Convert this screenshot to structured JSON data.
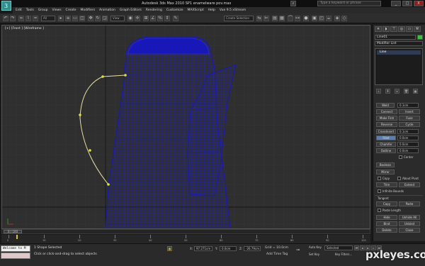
{
  "window": {
    "title": "Autodesk 3ds Max 2010 SP1   enamelware pov.max",
    "help_search_placeholder": "Type a keyword or phrase",
    "min": "_",
    "max": "□",
    "close": "X"
  },
  "menu": [
    "Edit",
    "Tools",
    "Group",
    "Views",
    "Create",
    "Modifiers",
    "Animation",
    "Graph Editors",
    "Rendering",
    "Customize",
    "MAXScript",
    "Help",
    "Vue 9.5 xStream"
  ],
  "toolbar": {
    "filter_dropdown": "All",
    "view_dropdown": "View",
    "selection_set": "Create Selection"
  },
  "viewport": {
    "label": "[ + ] [ Front ] [ Wireframe ]",
    "label_text": "[+] [Front ] [Wireframe ]"
  },
  "command_panel": {
    "object_name": "Line01",
    "modifier_list": "Modifier List",
    "stack_item": "Line",
    "buttons": {
      "weld": "Weld",
      "weld_val": "0.1cm",
      "connect": "Connect",
      "insert": "Insert",
      "make_first": "Make First",
      "fuse": "Fuse",
      "reverse": "Reverse",
      "cycle": "Cycle",
      "crossinsert": "CrossInsert",
      "crossinsert_val": "0.1cm",
      "fillet": "Fillet",
      "fillet_val": "0.0cm",
      "chamfer": "Chamfer",
      "chamfer_val": "0.0cm",
      "outline": "Outline",
      "outline_val": "0.0cm",
      "mirror_label": "Mirror",
      "boolean": "Boolean",
      "mirror": "Mirror",
      "copy": "Copy",
      "about_pivot": "About Pivot",
      "trim": "Trim",
      "extend": "Extend",
      "infinite_bounds": "Infinite Bounds",
      "tangent": "Tangent",
      "t_copy": "Copy",
      "t_paste": "Paste",
      "paste_length": "Paste Length",
      "hide": "Hide",
      "unhide_all": "Unhide All",
      "bind": "Bind",
      "unbind": "Unbind",
      "delete": "Delete",
      "close": "Close",
      "center": "Center"
    }
  },
  "timeline": {
    "thumb": "0 / 100",
    "ticks": [
      "0",
      "10",
      "20",
      "30",
      "40",
      "50",
      "60",
      "70",
      "80",
      "90",
      "100"
    ]
  },
  "status": {
    "maxscript": "Welcome to M",
    "line1": "1 Shape Selected",
    "line2": "Click or click-and-drag to select objects",
    "x_label": "X:",
    "x_val": "97.271cm",
    "y_label": "Y:",
    "y_val": "0.0cm",
    "z_label": "Z:",
    "z_val": "-26.79cm",
    "grid": "Grid = 10.0cm",
    "add_time_tag": "Add Time Tag",
    "auto_key": "Auto Key",
    "selected": "Selected",
    "set_key": "Set Key",
    "key_filters": "Key Filters..."
  },
  "watermark": "pxleyes.com",
  "colors": {
    "wireframe": "#1a1ab0",
    "spline": "#e8e0a0",
    "vertex": "#e0e040",
    "viewport_bg": "#2f2f2f"
  }
}
